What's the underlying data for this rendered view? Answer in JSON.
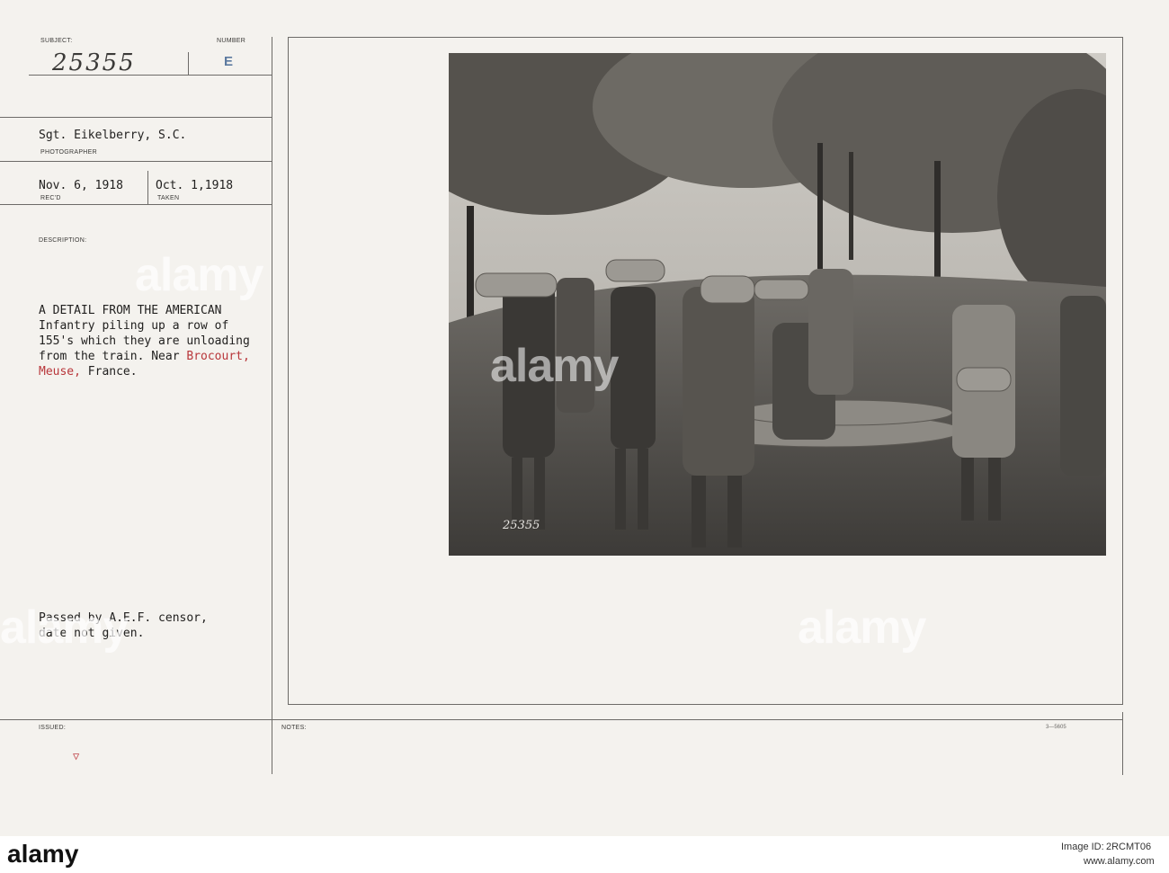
{
  "card": {
    "subject_label": "SUBJECT:",
    "subject_value": "25355",
    "number_label": "NUMBER",
    "number_value": "E",
    "photographer_name": "Sgt. Eikelberry, S.C.",
    "photographer_label": "PHOTOGRAPHER",
    "received_date": "Nov. 6, 1918",
    "received_label": "REC'D",
    "taken_date": "Oct. 1,1918",
    "taken_label": "TAKEN",
    "description_label": "DESCRIPTION:",
    "description_lines": [
      "A DETAIL FROM THE AMERICAN",
      "Infantry piling up a row of",
      "155's which they are unloading",
      "from the train. Near "
    ],
    "place_1": "Brocourt,",
    "place_2": "Meuse,",
    "place_tail": " France.",
    "censor_line_1": "Passed by A.E.F. censor,",
    "censor_line_2": "date not given.",
    "issued_label": "ISSUED:",
    "issued_mark": "▽",
    "notes_label": "NOTES:",
    "form_code": "3—5605",
    "photo_number": "25355"
  },
  "watermark": {
    "text": "alamy",
    "colors": {
      "red_text": "#b8363a",
      "stamp_blue": "#5c7aa0"
    }
  },
  "footer": {
    "brand": "alamy",
    "image_id_label": "Image ID:",
    "image_id": "2RCMT06",
    "site": "www.alamy.com"
  }
}
